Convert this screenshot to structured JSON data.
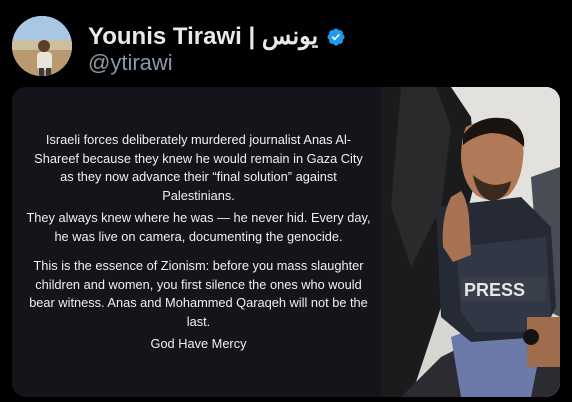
{
  "profile": {
    "display_name": "Younis Tirawi | يونس",
    "handle": "@ytirawi",
    "verified": true,
    "verified_color": "#1d9bf0"
  },
  "post_image": {
    "paragraphs": [
      "Israeli forces deliberately murdered journalist Anas Al-Shareef because they knew he would remain in Gaza City as they now advance their “final solution” against Palestinians.",
      "They always knew where he was — he never hid. Every day, he was live on camera, documenting the genocide.",
      "This is the essence of Zionism: before you mass slaughter children and women, you first silence the ones who would bear witness. Anas and Mohammed Qaraqeh will not be the last.",
      "God Have Mercy"
    ],
    "vest_label": "PRESS"
  },
  "colors": {
    "background": "#000000",
    "card_text_panel": "#14151a",
    "handle_gray": "#8b98a5",
    "text_primary": "#e7e9ea"
  }
}
